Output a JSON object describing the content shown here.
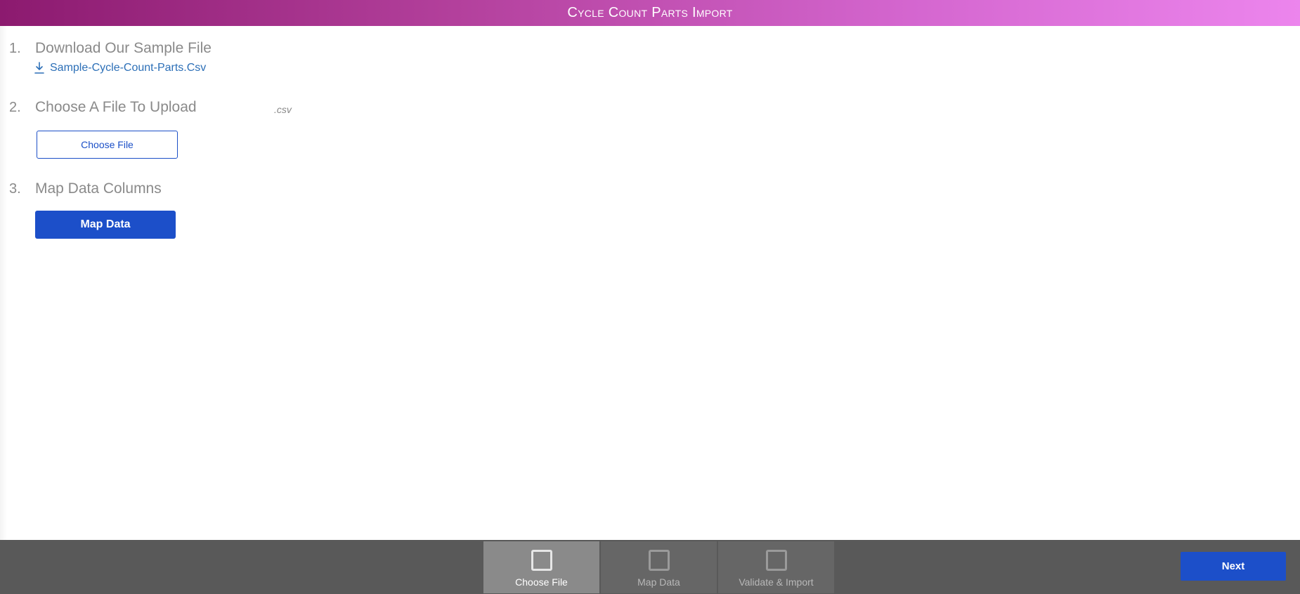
{
  "header": {
    "title": "Cycle Count Parts Import"
  },
  "steps": [
    {
      "number": "1.",
      "title": "Download Our Sample File"
    },
    {
      "number": "2.",
      "title": "Choose A File To Upload"
    },
    {
      "number": "3.",
      "title": "Map Data Columns"
    }
  ],
  "sample": {
    "filename": "Sample-Cycle-Count-Parts.Csv",
    "icon": "download-icon"
  },
  "upload": {
    "hint": ".csv",
    "button_label": "Choose File"
  },
  "map": {
    "button_label": "Map Data"
  },
  "footer": {
    "nav": [
      {
        "label": "Choose File",
        "active": true
      },
      {
        "label": "Map Data",
        "active": false
      },
      {
        "label": "Validate & Import",
        "active": false
      }
    ],
    "next_label": "Next"
  },
  "colors": {
    "header_gradient": [
      "#8c1a6f",
      "#ec85ed"
    ],
    "primary": "#1c4fc9",
    "link": "#2c6fb7",
    "footer_bg": "#595959"
  }
}
